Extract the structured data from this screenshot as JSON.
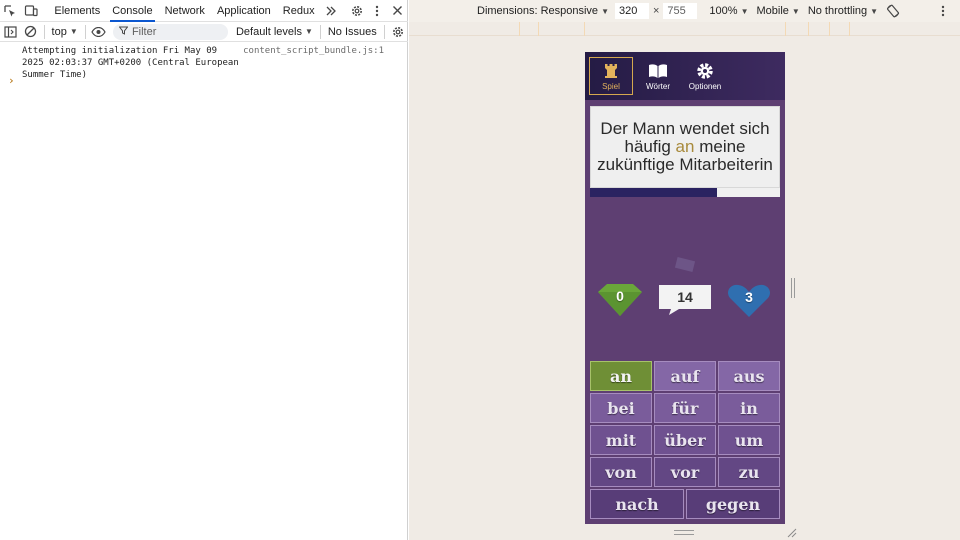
{
  "devtools": {
    "tabs": [
      {
        "label": "Elements",
        "active": false
      },
      {
        "label": "Console",
        "active": true
      },
      {
        "label": "Network",
        "active": false
      },
      {
        "label": "Application",
        "active": false
      },
      {
        "label": "Redux",
        "active": false
      }
    ],
    "toolbar": {
      "context": "top",
      "filter_placeholder": "Filter",
      "levels": "Default levels",
      "issues": "No Issues"
    },
    "console": {
      "messages": [
        {
          "text": "Attempting initialization Fri May 09 2025 02:03:37 GMT+0200 (Central European Summer Time)",
          "source": "content_script_bundle.js:1"
        }
      ],
      "prompt": "›"
    }
  },
  "device_toolbar": {
    "dimensions_label": "Dimensions: Responsive",
    "width": "320",
    "height": "755",
    "zoom": "100%",
    "device_type": "Mobile",
    "throttling": "No throttling"
  },
  "game": {
    "nav": [
      {
        "label": "Spiel",
        "icon": "tower-icon",
        "active": true
      },
      {
        "label": "Wörter",
        "icon": "book-icon",
        "active": false
      },
      {
        "label": "Optionen",
        "icon": "gear-icon",
        "active": false
      }
    ],
    "sentence_before": "Der Mann wendet sich häufig",
    "sentence_highlight": "an",
    "sentence_after": "meine zukünftige Mitarbeiterin",
    "progress": 0.67,
    "score": "0",
    "timer": "14",
    "lives": "3",
    "answers": [
      "an",
      "auf",
      "aus",
      "bei",
      "für",
      "in",
      "mit",
      "über",
      "um",
      "von",
      "vor",
      "zu",
      "nach",
      "gegen"
    ],
    "colors": {
      "correct": "#6f8f36",
      "score_gem": "#6aa63a",
      "lives_heart": "#2f6fb0"
    }
  }
}
